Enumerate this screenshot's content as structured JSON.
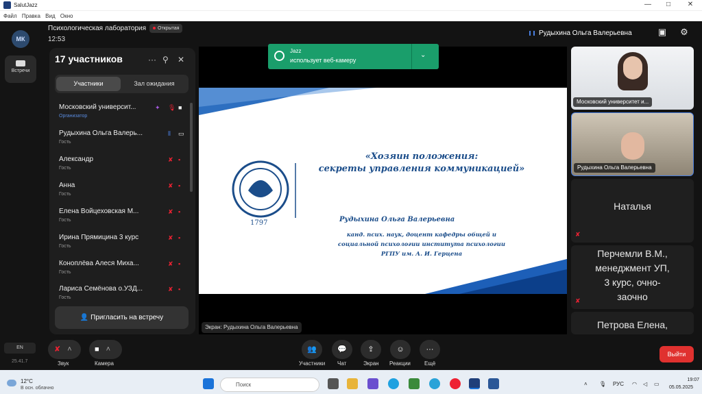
{
  "window": {
    "title": "SalutJazz",
    "controls": [
      "—",
      "□",
      "✕"
    ]
  },
  "menu": [
    "Файл",
    "Правка",
    "Вид",
    "Окно"
  ],
  "rail": {
    "avatar": "МК",
    "meetings_label": "Встречи",
    "lang": "EN",
    "version": "25.41.7"
  },
  "header": {
    "meeting_title": "Психологическая лаборатория",
    "status_badge": "Открытая",
    "time": "12:53",
    "speaker_name": "Рудыхина Ольга Валерьевна"
  },
  "panel": {
    "title": "17 участников",
    "tabs": [
      "Участники",
      "Зал ожидания"
    ],
    "participants": [
      {
        "name": "Московский университ...",
        "role": "Организатор"
      },
      {
        "name": "Рудыхина Ольга Валерь...",
        "role": "Гость"
      },
      {
        "name": "Александр",
        "role": "Гость"
      },
      {
        "name": "Анна",
        "role": "Гость"
      },
      {
        "name": "Елена Войцеховская М...",
        "role": "Гость"
      },
      {
        "name": "Ирина Прямицина 3 курс",
        "role": "Гость"
      },
      {
        "name": "Коноплёва Алеся Миха...",
        "role": "Гость"
      },
      {
        "name": "Лариса Семёнова о.УЗД...",
        "role": "Гость"
      }
    ],
    "invite_label": "Пригласить на встречу"
  },
  "notification": {
    "app": "Jazz",
    "text": "использует веб-камеру"
  },
  "slide": {
    "title_line1": "«Хозяин положения:",
    "title_line2": "секреты управления коммуникацией»",
    "author": "Рудыхина Ольга Валерьевна",
    "cred_line1": "канд. псих. наук, доцент кафедры общей и",
    "cred_line2": "социальной психологии института психологии",
    "cred_line3": "РГПУ им. А. И. Герцена",
    "year": "1797"
  },
  "screen_caption": "Экран: Рудыхина Ольга Валерьевна",
  "tiles": [
    {
      "label": "Московский университет и..."
    },
    {
      "label": "Рудыхина Ольга Валерьевна"
    },
    {
      "name": "Наталья"
    },
    {
      "name_line1": "Перчемли В.М.,",
      "name_line2": "менеджмент УП,",
      "name_line3": "3 курс, очно-",
      "name_line4": "заочно"
    },
    {
      "name": "Петрова Елена,"
    }
  ],
  "controls": {
    "sound": "Звук",
    "camera": "Камера",
    "participants": "Участники",
    "chat": "Чат",
    "screen": "Экран",
    "reactions": "Реакции",
    "more": "Ещё",
    "exit": "Выйти"
  },
  "taskbar": {
    "temp": "12°C",
    "weather": "В осн. облачно",
    "search_placeholder": "Поиск",
    "lang": "РУС",
    "time": "19:07",
    "date": "05.05.2025"
  }
}
